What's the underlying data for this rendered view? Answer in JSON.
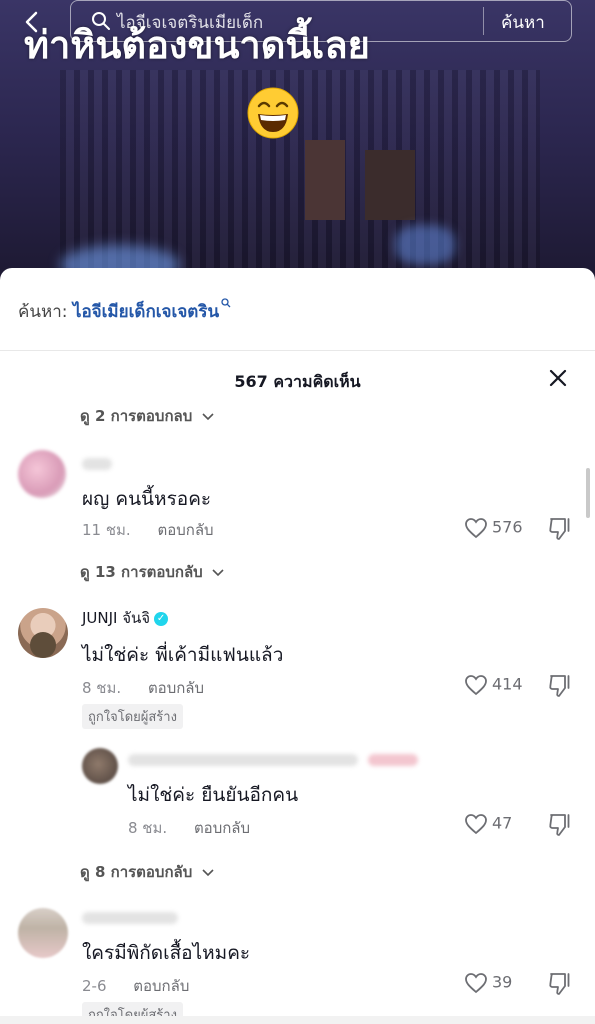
{
  "video": {
    "search_query": "ไอจีเจเจตรินเมียเด็ก",
    "search_button": "ค้นหา",
    "caption": "ท่าหินต้องขนาดนี้เลย",
    "emoji": "grinning-face"
  },
  "sheet": {
    "search_label": "ค้นหา:",
    "search_term": "ไอจีเมียเด็กเจเจตริน",
    "comment_count": "567 ความคิดเห็น"
  },
  "comments": [
    {
      "replies_toggle_above": "ดู 2 การตอบกลบ",
      "username": "",
      "text": "ผญ คนนี้หรอคะ",
      "time": "11 ชม.",
      "reply_label": "ตอบกลับ",
      "likes": "576",
      "replies_toggle": "ดู 13 การตอบกลับ"
    },
    {
      "username": "JUNJI จันจิ",
      "verified": true,
      "text": "ไม่ใช่ค่ะ พี่เค้ามีแฟนแล้ว",
      "time": "8 ชม.",
      "reply_label": "ตอบกลับ",
      "likes": "414",
      "badge": "ถูกใจโดยผู้สร้าง",
      "reply": {
        "username": "",
        "text": "ไม่ใช่ค่ะ ยืนยันอีกคน",
        "time": "8 ชม.",
        "reply_label": "ตอบกลับ",
        "likes": "47"
      },
      "replies_toggle": "ดู 8 การตอบกลับ"
    },
    {
      "username": "",
      "text": "ใครมีพิกัดเสื้อไหมคะ",
      "time": "2-6",
      "reply_label": "ตอบกลับ",
      "likes": "39",
      "badge": "ถูกใจโดยผู้สร้าง"
    }
  ],
  "colors": {
    "accent_link": "#2457a8",
    "verified": "#20d5ec",
    "text_primary": "#161823",
    "text_secondary": "#8a8b91"
  }
}
